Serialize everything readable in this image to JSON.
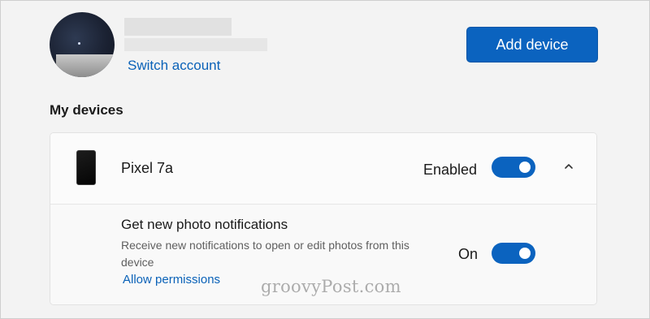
{
  "account": {
    "switch_label": "Switch account"
  },
  "header": {
    "add_device_label": "Add device"
  },
  "devices": {
    "section_title": "My devices",
    "items": [
      {
        "name": "Pixel 7a",
        "status_label": "Enabled",
        "enabled": true,
        "expanded": true,
        "options": [
          {
            "title": "Get new photo notifications",
            "description": "Receive new notifications to open or edit photos from this device",
            "link_label": "Allow permissions",
            "state_label": "On",
            "on": true
          }
        ]
      }
    ]
  },
  "watermark": "groovyPost.com",
  "colors": {
    "accent": "#0b63bf",
    "link": "#0a62b8",
    "background": "#f3f3f3"
  },
  "icons": {
    "expand": "chevron-up-icon",
    "device": "phone-icon"
  }
}
